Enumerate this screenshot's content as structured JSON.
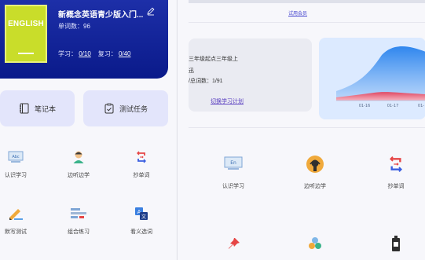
{
  "book": {
    "cover_text": "ENGLISH",
    "title": "新概念英语青少版入门...",
    "word_count_label": "单词数：",
    "word_count": "96",
    "learn_label": "学习：",
    "learn_value": "0/10",
    "review_label": "复习：",
    "review_value": "0/40"
  },
  "quick": {
    "notebook": "笔记本",
    "test_task": "测试任务"
  },
  "left_functions": [
    {
      "label": "认识学习",
      "icon": "abc-card-icon"
    },
    {
      "label": "边听边学",
      "icon": "listener-icon"
    },
    {
      "label": "抄单词",
      "icon": "swap-icon"
    },
    {
      "label": "默写测试",
      "icon": "pen-write-icon"
    },
    {
      "label": "组合练习",
      "icon": "blocks-icon"
    },
    {
      "label": "看义选词",
      "icon": "translate-icon"
    }
  ],
  "right": {
    "trial_link": "试用会员",
    "info_line1": "三年级起点三年级上",
    "info_line2": "迅",
    "info_line3": "/总词数：1/91",
    "plan_link": "切换学习计划",
    "chart_ticks": [
      "01-16",
      "01-17",
      "01-"
    ],
    "functions": [
      {
        "label": "认识学习",
        "icon": "en-board-icon"
      },
      {
        "label": "边听边学",
        "icon": "headphone-icon"
      },
      {
        "label": "抄单词",
        "icon": "swap-icon"
      }
    ]
  },
  "chart_data": {
    "type": "area",
    "categories": [
      "01-16",
      "01-17",
      "01-"
    ],
    "series": [
      {
        "values": [
          0.35,
          0.45,
          0.75,
          0.85,
          0.8,
          0.7
        ]
      },
      {
        "values": [
          0.08,
          0.1,
          0.14,
          0.12,
          0.09,
          0.08
        ]
      }
    ],
    "colors": {
      "blue": "#3b8ef0",
      "red": "#e85a70"
    }
  },
  "colors": {
    "accent": "#1d2fa8",
    "card": "#e3e5fb"
  }
}
